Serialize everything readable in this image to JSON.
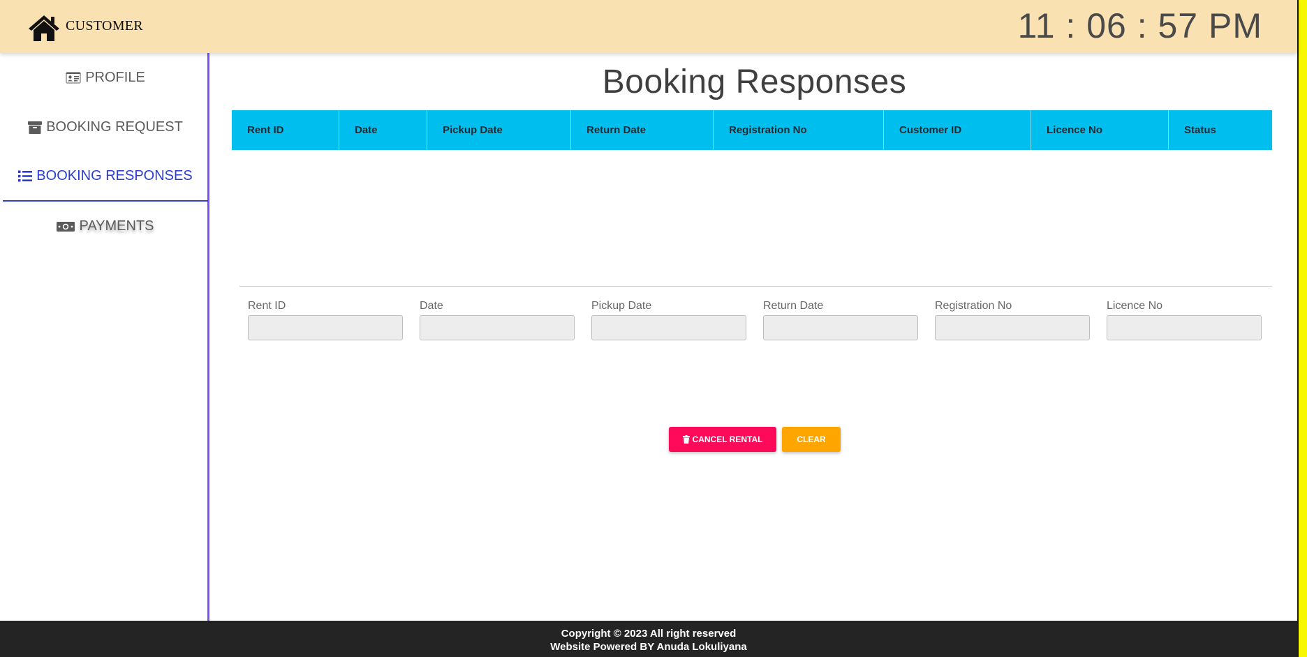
{
  "header": {
    "home_label": "CUSTOMER",
    "clock": "11 : 06 : 57 PM"
  },
  "sidebar": {
    "items": [
      {
        "label": "PROFILE",
        "icon": "id-card-icon",
        "active": false
      },
      {
        "label": "BOOKING REQUEST",
        "icon": "archive-box-icon",
        "active": false
      },
      {
        "label": "BOOKING RESPONSES",
        "icon": "list-icon",
        "active": true
      },
      {
        "label": "PAYMENTS",
        "icon": "money-bill-icon",
        "active": false
      }
    ]
  },
  "main": {
    "title": "Booking Responses",
    "table": {
      "columns": [
        "Rent ID",
        "Date",
        "Pickup Date",
        "Return Date",
        "Registration No",
        "Customer ID",
        "Licence No",
        "Status"
      ],
      "rows": []
    },
    "form": {
      "fields": [
        {
          "label": "Rent ID",
          "value": ""
        },
        {
          "label": "Date",
          "value": ""
        },
        {
          "label": "Pickup Date",
          "value": ""
        },
        {
          "label": "Return Date",
          "value": ""
        },
        {
          "label": "Registration No",
          "value": ""
        },
        {
          "label": "Licence No",
          "value": ""
        }
      ]
    },
    "buttons": {
      "cancel_label": "CANCEL RENTAL",
      "clear_label": "CLEAR"
    }
  },
  "footer": {
    "line1": "Copyright © 2023 All right reserved",
    "line2": "Website Powered BY Anuda Lokuliyana"
  },
  "colors": {
    "header_bg": "#f9e1b2",
    "table_header_bg": "#00bfee",
    "active_nav": "#2b3ccf",
    "sidebar_border": "#7c4dff",
    "cancel_button": "#ff0a5a",
    "clear_button": "#ffa500",
    "footer_bg": "#242424"
  }
}
